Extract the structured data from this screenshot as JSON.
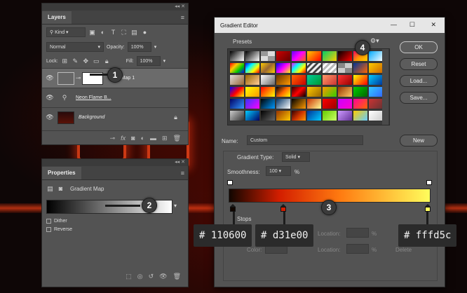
{
  "layers_panel": {
    "tab": "Layers",
    "filter_kind": "Kind",
    "blend_mode": "Normal",
    "opacity_label": "Opacity:",
    "opacity_value": "100%",
    "lock_label": "Lock:",
    "fill_label": "Fill:",
    "fill_value": "100%",
    "layers": [
      {
        "name": "ent Map 1",
        "visible": true,
        "selected": true
      },
      {
        "name": "Neon Flame B...",
        "visible": true,
        "selected": false
      },
      {
        "name": "Background",
        "visible": true,
        "selected": false,
        "locked": true
      }
    ]
  },
  "properties_panel": {
    "tab": "Properties",
    "adjustment_title": "Gradient Map",
    "dither_label": "Dither",
    "reverse_label": "Reverse"
  },
  "gradient_editor": {
    "title": "Gradient Editor",
    "presets_label": "Presets",
    "buttons": {
      "ok": "OK",
      "reset": "Reset",
      "load": "Load...",
      "save": "Save...",
      "new": "New"
    },
    "name_label": "Name:",
    "name_value": "Custom",
    "gradient_type_label": "Gradient Type:",
    "gradient_type_value": "Solid",
    "smoothness_label": "Smoothness:",
    "smoothness_value": "100",
    "smoothness_unit": "%",
    "stops_label": "Stops",
    "location_label": "Location:",
    "percent": "%",
    "color_label": "Color:",
    "delete_label": "Delete",
    "gradient_colors": [
      "#110600",
      "#d31e00",
      "#fffd5c"
    ]
  },
  "annotations": {
    "badges": [
      "1",
      "2",
      "3",
      "4"
    ],
    "hex_labels": [
      "# 110600",
      "# d31e00",
      "# fffd5c"
    ]
  },
  "preset_gradients": [
    "linear-gradient(135deg,#000,#fff)",
    "linear-gradient(135deg,#000,#fff)",
    "repeating-conic-gradient(#ddd 0 25%,#999 0 50%)",
    "linear-gradient(135deg,#c00,#600)",
    "linear-gradient(135deg,#60f,#f0f,#f60)",
    "linear-gradient(135deg,#fc0,#f00)",
    "linear-gradient(135deg,#0c6,#fc0)",
    "linear-gradient(135deg,#000,#f00)",
    "linear-gradient(135deg,#f06,#f90,#fc0)",
    "linear-gradient(135deg,#0af,#fff)",
    "linear-gradient(135deg,#f00,#fc0,#0c0,#00f)",
    "linear-gradient(135deg,#00f,#0ff,#ff0,#f00)",
    "linear-gradient(135deg,#fc0,#963,#fc0)",
    "linear-gradient(135deg,#00f,#f0f,#ff0)",
    "linear-gradient(135deg,#f0f,#0ff,#ff0,#f00)",
    "repeating-linear-gradient(135deg,#eee 0 3px,#444 3px 6px)",
    "repeating-linear-gradient(135deg,#bbb 0 3px,#fff 3px 6px)",
    "repeating-conic-gradient(#ccc 0 25%,#888 0 50%)",
    "linear-gradient(135deg,#039,#f60)",
    "linear-gradient(135deg,#fc0,#c60)",
    "linear-gradient(135deg,#ddd,#963)",
    "linear-gradient(135deg,#960,#fc9)",
    "linear-gradient(135deg,#fff,#666)",
    "linear-gradient(135deg,#630,#f90)",
    "linear-gradient(135deg,#f60,#c00)",
    "linear-gradient(135deg,#0c9,#093)",
    "linear-gradient(135deg,#f96,#c33)",
    "linear-gradient(135deg,#f33,#900)",
    "linear-gradient(135deg,#ff0,#f00)",
    "linear-gradient(135deg,#0cf,#039)",
    "linear-gradient(135deg,#00f,#f00,#ff0)",
    "linear-gradient(135deg,#ff0,#f90)",
    "linear-gradient(135deg,#f00,#ff0)",
    "linear-gradient(135deg,#000,#f60,#ff0)",
    "linear-gradient(135deg,#300,#f00,#000)",
    "linear-gradient(135deg,#fc0,#960)",
    "linear-gradient(135deg,#f90,#3c0)",
    "linear-gradient(135deg,#930,#fc6)",
    "linear-gradient(135deg,#0c0,#060)",
    "linear-gradient(135deg,#3cf,#36f)",
    "linear-gradient(135deg,#006,#39f)",
    "linear-gradient(135deg,#33f,#f0f)",
    "linear-gradient(135deg,#000,#09f)",
    "linear-gradient(135deg,#036,#fff)",
    "linear-gradient(135deg,#000,#f90)",
    "linear-gradient(135deg,#c30,#ff9)",
    "linear-gradient(135deg,#f00,#900)",
    "linear-gradient(135deg,#c0f,#f0c)",
    "linear-gradient(135deg,#f09,#f60)",
    "linear-gradient(135deg,#c33,#633)",
    "linear-gradient(135deg,#ccc,#333)",
    "linear-gradient(135deg,#0cf,#006)",
    "linear-gradient(135deg,#000,#666)",
    "linear-gradient(135deg,#930,#fc0)",
    "linear-gradient(135deg,#300,#c30,#f90)",
    "linear-gradient(135deg,#039,#0cf)",
    "linear-gradient(135deg,#6c0,#cf6)",
    "linear-gradient(135deg,#c9f,#639)",
    "linear-gradient(135deg,#fc0,#6cf)",
    "linear-gradient(135deg,#fff,#ccc)"
  ]
}
